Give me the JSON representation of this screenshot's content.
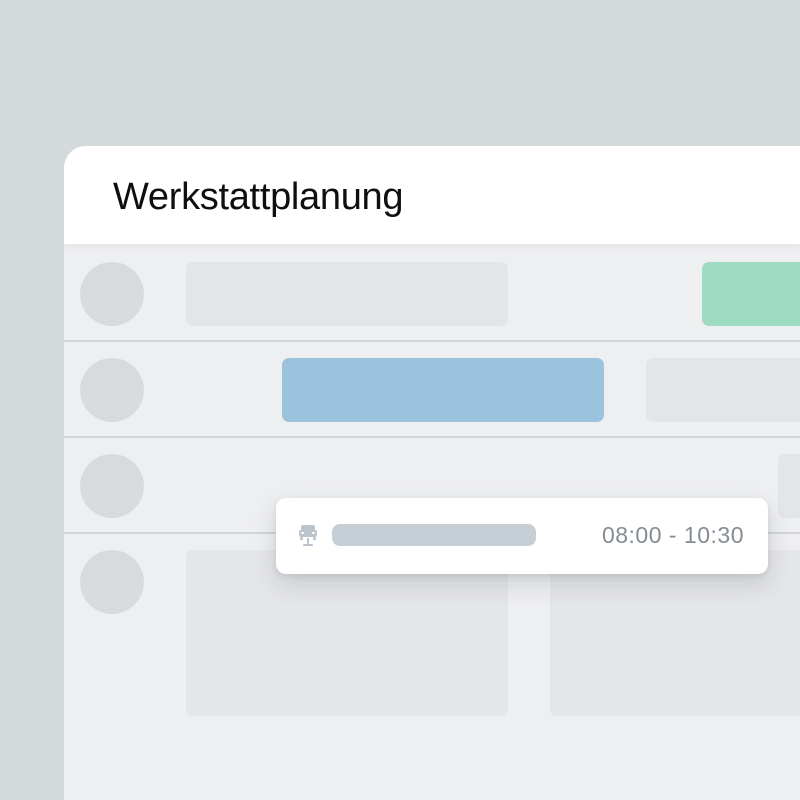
{
  "app": {
    "title": "Werkstattplanung"
  },
  "popup": {
    "icon": "car-icon",
    "time_range": "08:00 - 10:30"
  },
  "colors": {
    "background": "#d4d9dc",
    "appointment_green": "#9ddcc2",
    "appointment_blue": "#9cc3de",
    "placeholder_gray": "#e4e5e7"
  }
}
